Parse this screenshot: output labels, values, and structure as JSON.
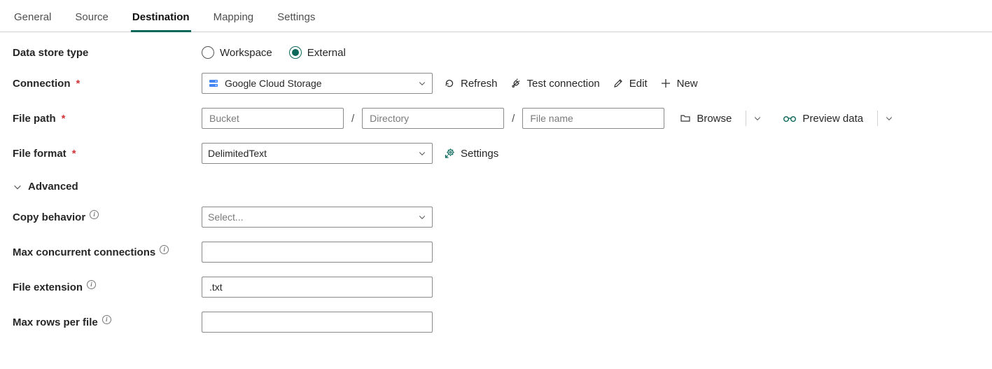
{
  "tabs": {
    "general": "General",
    "source": "Source",
    "destination": "Destination",
    "mapping": "Mapping",
    "settings": "Settings",
    "active": "destination"
  },
  "labels": {
    "data_store_type": "Data store type",
    "connection": "Connection",
    "file_path": "File path",
    "file_format": "File format",
    "advanced": "Advanced",
    "copy_behavior": "Copy behavior",
    "max_concurrent": "Max concurrent connections",
    "file_extension": "File extension",
    "max_rows": "Max rows per file"
  },
  "data_store_type": {
    "options": {
      "workspace": "Workspace",
      "external": "External"
    },
    "selected": "external"
  },
  "connection": {
    "value": "Google Cloud Storage",
    "actions": {
      "refresh": "Refresh",
      "test": "Test connection",
      "edit": "Edit",
      "new": "New"
    }
  },
  "file_path": {
    "bucket": {
      "value": "",
      "placeholder": "Bucket"
    },
    "directory": {
      "value": "",
      "placeholder": "Directory"
    },
    "filename": {
      "value": "",
      "placeholder": "File name"
    },
    "actions": {
      "browse": "Browse",
      "preview": "Preview data"
    }
  },
  "file_format": {
    "value": "DelimitedText",
    "settings_label": "Settings"
  },
  "copy_behavior": {
    "value": "",
    "placeholder": "Select..."
  },
  "max_concurrent": {
    "value": ""
  },
  "file_extension": {
    "value": ".txt"
  },
  "max_rows": {
    "value": ""
  },
  "colors": {
    "accent": "#0c695a"
  }
}
